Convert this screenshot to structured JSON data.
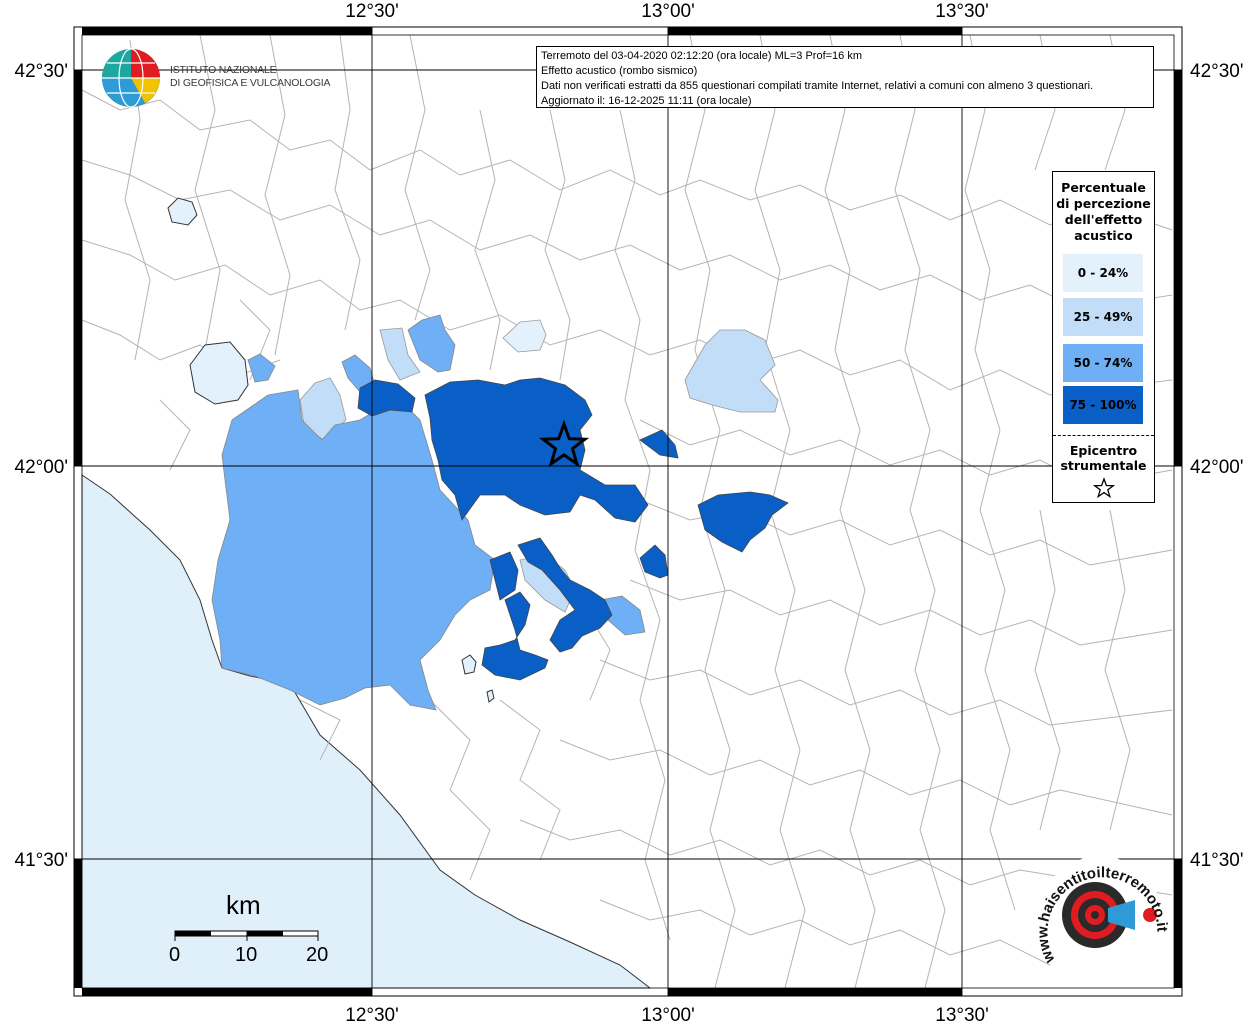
{
  "info": {
    "line1": "Terremoto del 03-04-2020 02:12:20 (ora locale) ML=3 Prof=16 km",
    "line2": "Effetto acustico (rombo sismico)",
    "line3": "Dati non verificati estratti da 855 questionari compilati tramite Internet, relativi a comuni con almeno 3 questionari.",
    "line4": "Aggiornato il: 16-12-2025 11:11 (ora locale)"
  },
  "logo": {
    "line1": "ISTITUTO NAZIONALE",
    "line2": "DI GEOFISICA E VULCANOLOGIA"
  },
  "axes": {
    "top": [
      "12°30'",
      "13°00'",
      "13°30'"
    ],
    "bottom": [
      "12°30'",
      "13°00'",
      "13°30'"
    ],
    "left": [
      "42°30'",
      "42°00'",
      "41°30'"
    ],
    "right": [
      "42°30'",
      "42°00'",
      "41°30'"
    ]
  },
  "legend": {
    "title_lines": [
      "Percentuale",
      "di percezione",
      "dell'effetto",
      "acustico"
    ],
    "classes": [
      {
        "label": "0 - 24%",
        "color": "#e3f1fd"
      },
      {
        "label": "25 - 49%",
        "color": "#c2ddf7"
      },
      {
        "label": "50 - 74%",
        "color": "#6eaff5"
      },
      {
        "label": "75 - 100%",
        "color": "#0a5fc6"
      }
    ],
    "epicenter_lines": [
      "Epicentro",
      "strumentale"
    ]
  },
  "scalebar": {
    "unit": "km",
    "ticks": [
      "0",
      "10",
      "20"
    ]
  },
  "badge": {
    "text": "www.haisentitoilterremoto.it"
  },
  "colors": {
    "sea": "#dff0fb",
    "land": "#ffffff",
    "borders": "#b4b4b4",
    "grid": "#000000"
  }
}
